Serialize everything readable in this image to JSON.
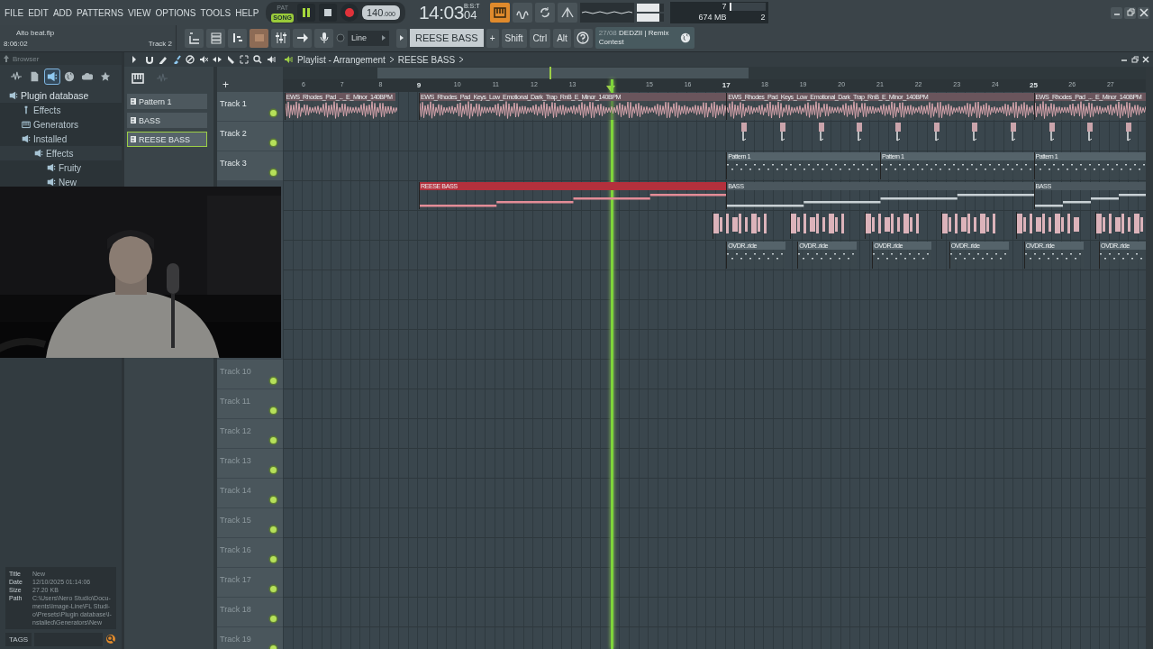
{
  "menu": [
    "FILE",
    "EDIT",
    "ADD",
    "PATTERNS",
    "VIEW",
    "OPTIONS",
    "TOOLS",
    "HELP"
  ],
  "transport": {
    "modes": [
      {
        "label": "PAT",
        "selected": false
      },
      {
        "label": "SONG",
        "selected": true
      }
    ],
    "playing": true,
    "tempo": "140",
    "tempo_fraction": ".000",
    "time": "14:03",
    "time_ticks": "04",
    "time_label": "B:S:T"
  },
  "mixer_sliders": [
    {
      "level": 0.85
    },
    {
      "level": 0.85
    }
  ],
  "monitor": {
    "cpu": {
      "level": 0.06,
      "reading": "7"
    },
    "memory": "674 MB",
    "polyphony": "2"
  },
  "hint": {
    "file": "Alto beat.flp",
    "time": "8:06:02",
    "target": "Track 2"
  },
  "windows": [
    {
      "kind": "playlist",
      "on": false
    },
    {
      "kind": "channels",
      "on": false
    },
    {
      "kind": "piano",
      "on": false
    },
    {
      "kind": "browser",
      "on": true
    },
    {
      "kind": "mixer",
      "on": false
    },
    {
      "kind": "arrow",
      "on": false
    },
    {
      "kind": "mic",
      "on": false
    }
  ],
  "snap": "Line",
  "pattern_selector": {
    "name": "REESE BASS",
    "add": "+"
  },
  "modifiers": [
    "Shift",
    "Ctrl",
    "Alt"
  ],
  "news": {
    "date": "27/08",
    "text": "DEDZII | Remix Contest"
  },
  "browser": {
    "title": "Browser",
    "tabs": [
      {
        "kind": "wave",
        "selected": false
      },
      {
        "kind": "file",
        "selected": false
      },
      {
        "kind": "plugin",
        "selected": true
      },
      {
        "kind": "globe",
        "selected": false
      },
      {
        "kind": "cloud",
        "selected": false
      },
      {
        "kind": "star",
        "selected": false
      }
    ],
    "tree": [
      {
        "label": "Plugin database",
        "kind": "plugin",
        "children": [
          {
            "label": "Effects",
            "kind": "effect"
          },
          {
            "label": "Generators",
            "kind": "generator"
          },
          {
            "label": "Installed",
            "kind": "plugin",
            "children": [
              {
                "label": "Effects",
                "kind": "plugin",
                "children": [
                  {
                    "label": "Fruity",
                    "kind": "plugin"
                  },
                  {
                    "label": "New",
                    "kind": "plugin"
                  }
                ]
              }
            ]
          }
        ]
      }
    ],
    "file_info": [
      {
        "key": "Title",
        "lines": [
          "New"
        ]
      },
      {
        "key": "Date",
        "lines": [
          "12/10/2025 01:14:06"
        ]
      },
      {
        "key": "Size",
        "lines": [
          "27.20 KB"
        ]
      },
      {
        "key": "Path",
        "lines": [
          "C:\\Users\\Nero Studio\\Docu-",
          "ments\\Image-Line\\FL Studi-",
          "o\\Presets\\Plugin database\\I-",
          "nstalled\\Generators\\New"
        ]
      }
    ],
    "tags_button": "TAGS"
  },
  "patterns": [
    {
      "name": "Pattern 1",
      "selected": false
    },
    {
      "name": "BASS",
      "selected": false
    },
    {
      "name": "REESE BASS",
      "selected": true
    }
  ],
  "playlist": {
    "title": "Playlist - Arrangement",
    "pattern": "REESE BASS",
    "add_track": "+",
    "ruler": [
      "6",
      "7",
      "8",
      "9",
      "10",
      "11",
      "12",
      "13",
      "15",
      "16",
      "17",
      "18",
      "19",
      "20",
      "21",
      "22",
      "23",
      "24",
      "25",
      "26",
      "27"
    ],
    "tracks": [
      {
        "name": "Track 1",
        "enabled": true,
        "clips": [
          {
            "kind": "audio",
            "title": "EWS_Rhodes_Pad_..._E_Minor_140BPM"
          },
          {
            "kind": "audio",
            "title": "EWS_Rhodes_Pad_Keys_Low_Emotional_Dark_Trap_RnB_E_Minor_140BPM"
          },
          {
            "kind": "audio",
            "title": "EWS_Rhodes_Pad_Keys_Low_Emotional_Dark_Trap_RnB_E_Minor_140BPM"
          },
          {
            "kind": "audio",
            "title": "EWS_Rhodes_Pad_..._E_Minor_140BPM"
          }
        ]
      },
      {
        "name": "Track 2",
        "enabled": true,
        "clips": [
          {
            "kind": "hit"
          },
          {
            "kind": "hit"
          },
          {
            "kind": "hit"
          },
          {
            "kind": "hit"
          },
          {
            "kind": "hit"
          },
          {
            "kind": "hit"
          },
          {
            "kind": "hit"
          },
          {
            "kind": "hit"
          },
          {
            "kind": "hit"
          },
          {
            "kind": "hit"
          },
          {
            "kind": "hit"
          }
        ]
      },
      {
        "name": "Track 3",
        "enabled": true,
        "clips": [
          {
            "kind": "pattern",
            "title": "Pattern 1"
          },
          {
            "kind": "pattern",
            "title": "Pattern 1"
          },
          {
            "kind": "pattern",
            "title": "Pattern 1"
          }
        ]
      },
      {
        "clips": [
          {
            "kind": "notes",
            "title": "REESE BASS",
            "color": "#b3303c"
          },
          {
            "kind": "notes",
            "title": "BASS",
            "color": "#4b575e"
          },
          {
            "kind": "notes",
            "title": "BASS",
            "color": "#4b575e"
          }
        ]
      },
      {
        "clips": [
          {
            "kind": "drums"
          },
          {
            "kind": "drums"
          },
          {
            "kind": "drums"
          },
          {
            "kind": "drums"
          },
          {
            "kind": "drums"
          },
          {
            "kind": "drums"
          }
        ]
      },
      {
        "clips": [
          {
            "kind": "pattern",
            "title": "OVDR..ride"
          },
          {
            "kind": "pattern",
            "title": "OVDR..ride"
          },
          {
            "kind": "pattern",
            "title": "OVDR..ride"
          },
          {
            "kind": "pattern",
            "title": "OVDR..ride"
          },
          {
            "kind": "pattern",
            "title": "OVDR..ride"
          },
          {
            "kind": "pattern",
            "title": "OVDR..ride"
          }
        ]
      },
      {
        "name": "Track 10",
        "enabled": true
      },
      {
        "name": "Track 11",
        "enabled": true
      },
      {
        "name": "Track 12",
        "enabled": true
      },
      {
        "name": "Track 13",
        "enabled": true
      },
      {
        "name": "Track 14",
        "enabled": true
      },
      {
        "name": "Track 15",
        "enabled": true
      },
      {
        "name": "Track 16",
        "enabled": true
      },
      {
        "name": "Track 17",
        "enabled": true
      },
      {
        "name": "Track 18",
        "enabled": true
      },
      {
        "name": "Track 19",
        "enabled": true
      }
    ]
  },
  "webcam": {
    "kind": "picture"
  }
}
